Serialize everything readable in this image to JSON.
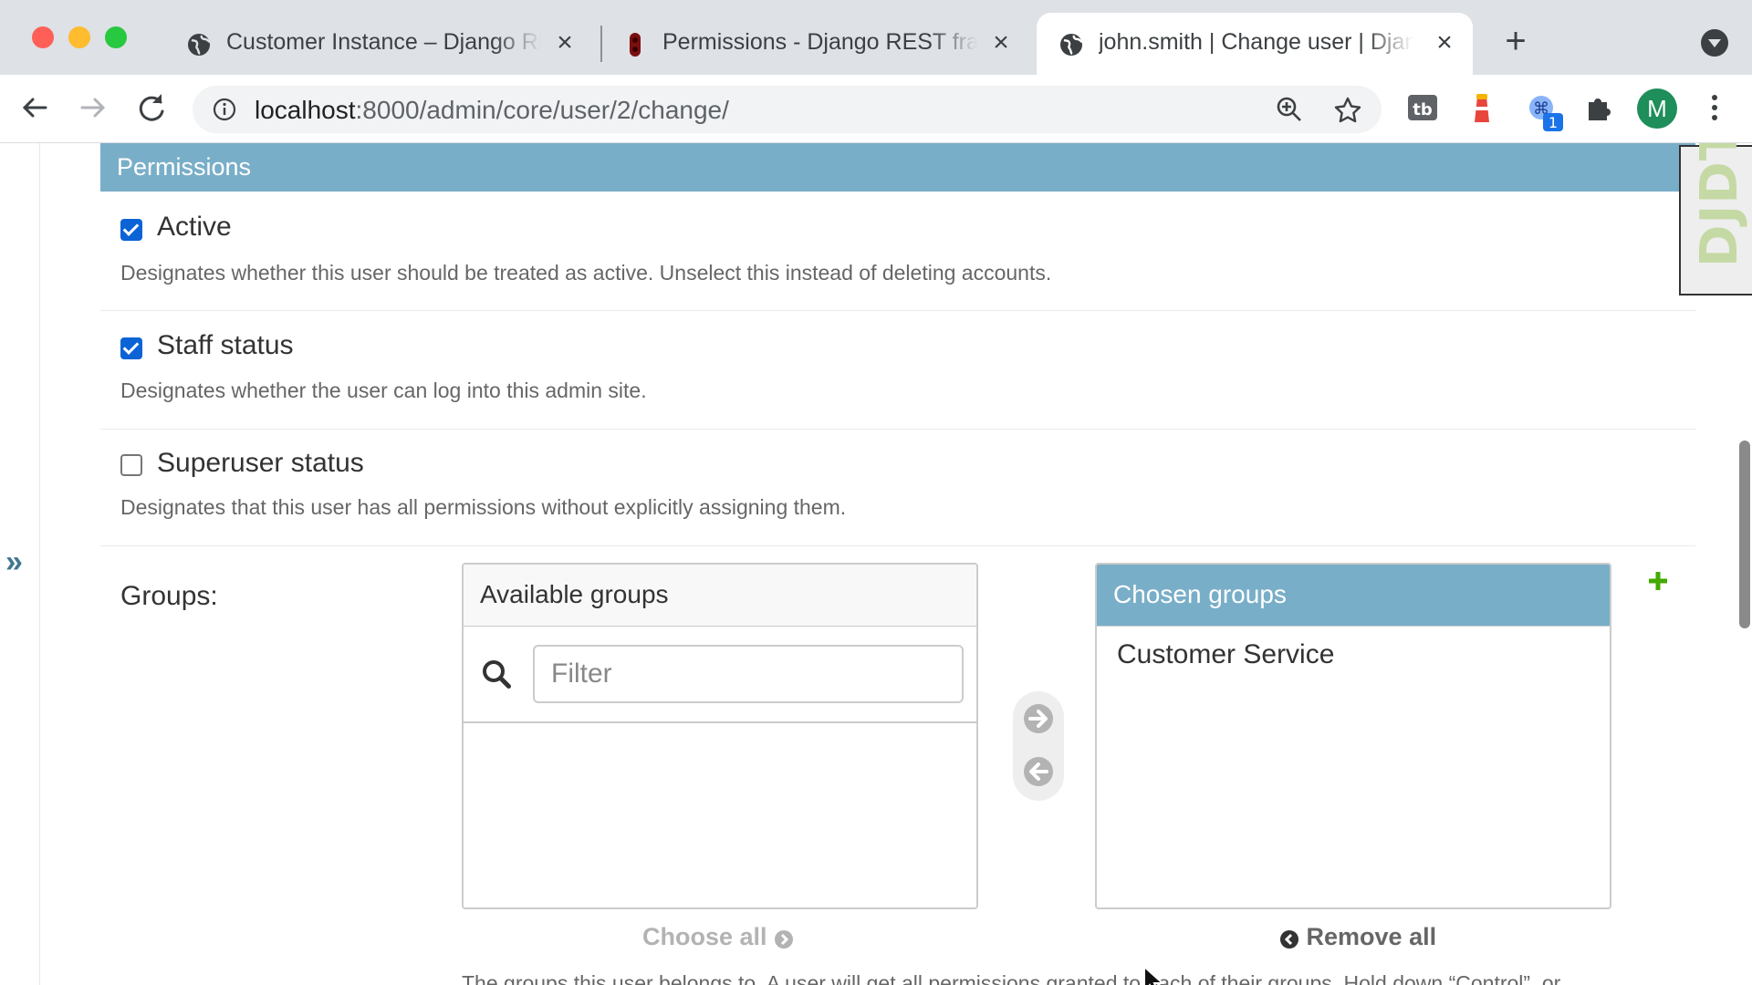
{
  "browser": {
    "tabs": [
      {
        "title": "Customer Instance – Django REST framework",
        "favicon": "globe-icon",
        "active": false
      },
      {
        "title": "Permissions - Django REST framework",
        "favicon": "drf-icon",
        "active": false
      },
      {
        "title": "john.smith | Change user | Django site admin",
        "favicon": "globe-icon",
        "active": true
      }
    ],
    "url_host": "localhost",
    "url_path": ":8000/admin/core/user/2/change/",
    "profile_initial": "M",
    "extension_badge": "1"
  },
  "page": {
    "section_title": "Permissions",
    "fields": [
      {
        "label": "Active",
        "checked": true,
        "help": "Designates whether this user should be treated as active. Unselect this instead of deleting accounts."
      },
      {
        "label": "Staff status",
        "checked": true,
        "help": "Designates whether the user can log into this admin site."
      },
      {
        "label": "Superuser status",
        "checked": false,
        "help": "Designates that this user has all permissions without explicitly assigning them."
      }
    ],
    "groups": {
      "label": "Groups:",
      "available_title": "Available groups",
      "filter_placeholder": "Filter",
      "available_items": [],
      "chosen_title": "Chosen groups",
      "chosen_items": [
        "Customer Service"
      ],
      "choose_all": "Choose all",
      "remove_all": "Remove all",
      "help_partial": "The groups this user belongs to. A user will get all permissions granted to each of their groups. Hold down “Control”, or"
    },
    "debug_toolbar_label": "DJDT"
  },
  "colors": {
    "section_header": "#79aec8",
    "checkbox_on": "#0b63d6",
    "add_plus": "#44aa00",
    "link_blue": "#417690"
  }
}
